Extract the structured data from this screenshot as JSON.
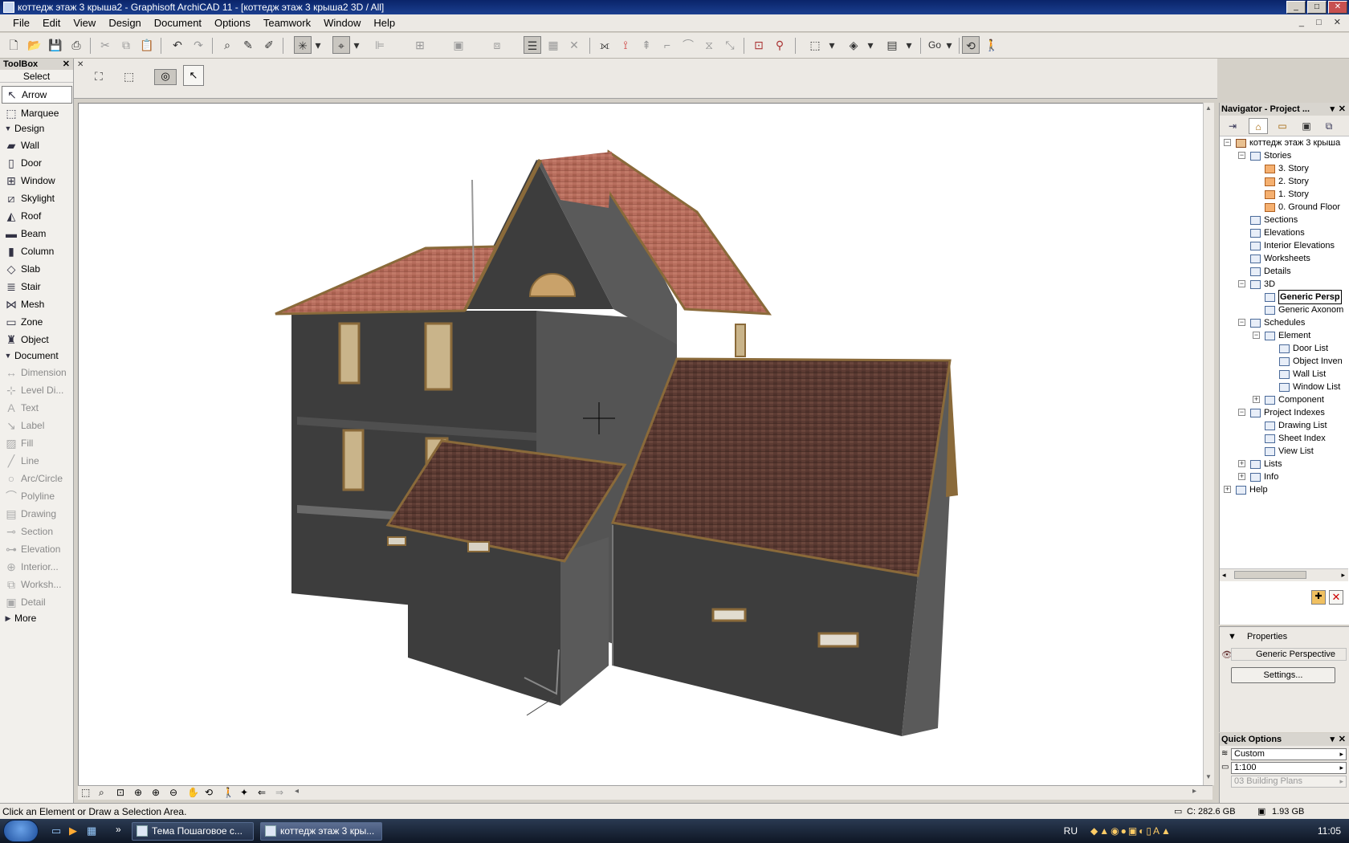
{
  "window": {
    "title": "коттедж этаж 3 крыша2 - Graphisoft ArchiCAD 11 - [коттедж этаж 3 крыша2 3D / All]",
    "minimize": "_",
    "maximize": "□",
    "close": "✕"
  },
  "menubar": {
    "items": [
      "File",
      "Edit",
      "View",
      "Design",
      "Document",
      "Options",
      "Teamwork",
      "Window",
      "Help"
    ],
    "mdi_controls": "_ □ ✕"
  },
  "toolbar": {
    "go_label": "Go"
  },
  "toolbox": {
    "title": "ToolBox",
    "close": "✕",
    "select_label": "Select",
    "select_tools": [
      {
        "label": "Arrow",
        "icon": "arrow-icon"
      },
      {
        "label": "Marquee",
        "icon": "marquee-icon"
      }
    ],
    "design_group": "Design",
    "design_tools": [
      {
        "label": "Wall",
        "icon": "wall-icon"
      },
      {
        "label": "Door",
        "icon": "door-icon"
      },
      {
        "label": "Window",
        "icon": "window-icon"
      },
      {
        "label": "Skylight",
        "icon": "skylight-icon"
      },
      {
        "label": "Roof",
        "icon": "roof-icon"
      },
      {
        "label": "Beam",
        "icon": "beam-icon"
      },
      {
        "label": "Column",
        "icon": "column-icon"
      },
      {
        "label": "Slab",
        "icon": "slab-icon"
      },
      {
        "label": "Stair",
        "icon": "stair-icon"
      },
      {
        "label": "Mesh",
        "icon": "mesh-icon"
      },
      {
        "label": "Zone",
        "icon": "zone-icon"
      },
      {
        "label": "Object",
        "icon": "object-icon"
      }
    ],
    "document_group": "Document",
    "document_tools": [
      {
        "label": "Dimension",
        "icon": "dimension-icon"
      },
      {
        "label": "Level Di...",
        "icon": "level-dimension-icon"
      },
      {
        "label": "Text",
        "icon": "text-icon"
      },
      {
        "label": "Label",
        "icon": "label-icon"
      },
      {
        "label": "Fill",
        "icon": "fill-icon"
      },
      {
        "label": "Line",
        "icon": "line-icon"
      },
      {
        "label": "Arc/Circle",
        "icon": "arc-circle-icon"
      },
      {
        "label": "Polyline",
        "icon": "polyline-icon"
      },
      {
        "label": "Drawing",
        "icon": "drawing-icon"
      },
      {
        "label": "Section",
        "icon": "section-icon"
      },
      {
        "label": "Elevation",
        "icon": "elevation-icon"
      },
      {
        "label": "Interior...",
        "icon": "interior-elevation-icon"
      },
      {
        "label": "Worksh...",
        "icon": "worksheet-icon"
      },
      {
        "label": "Detail",
        "icon": "detail-icon"
      }
    ],
    "more_label": "More"
  },
  "navigator": {
    "title": "Navigator - Project ...",
    "tree": [
      {
        "label": "коттедж этаж 3 крыша",
        "depth": 0,
        "icon": "house",
        "toggle": "−"
      },
      {
        "label": "Stories",
        "depth": 1,
        "icon": "folder",
        "toggle": "−"
      },
      {
        "label": "3. Story",
        "depth": 2,
        "icon": "story",
        "toggle": ""
      },
      {
        "label": "2. Story",
        "depth": 2,
        "icon": "story",
        "toggle": ""
      },
      {
        "label": "1. Story",
        "depth": 2,
        "icon": "story",
        "toggle": ""
      },
      {
        "label": "0. Ground Floor",
        "depth": 2,
        "icon": "story",
        "toggle": ""
      },
      {
        "label": "Sections",
        "depth": 1,
        "icon": "folder",
        "toggle": ""
      },
      {
        "label": "Elevations",
        "depth": 1,
        "icon": "folder",
        "toggle": ""
      },
      {
        "label": "Interior Elevations",
        "depth": 1,
        "icon": "folder",
        "toggle": ""
      },
      {
        "label": "Worksheets",
        "depth": 1,
        "icon": "folder",
        "toggle": ""
      },
      {
        "label": "Details",
        "depth": 1,
        "icon": "folder",
        "toggle": ""
      },
      {
        "label": "3D",
        "depth": 1,
        "icon": "folder",
        "toggle": "−"
      },
      {
        "label": "Generic Persp",
        "depth": 2,
        "icon": "camera",
        "toggle": "",
        "selected": true
      },
      {
        "label": "Generic Axonom",
        "depth": 2,
        "icon": "cube",
        "toggle": ""
      },
      {
        "label": "Schedules",
        "depth": 1,
        "icon": "folder",
        "toggle": "−"
      },
      {
        "label": "Element",
        "depth": 2,
        "icon": "folder",
        "toggle": "−"
      },
      {
        "label": "Door List",
        "depth": 3,
        "icon": "list",
        "toggle": ""
      },
      {
        "label": "Object Inven",
        "depth": 3,
        "icon": "list",
        "toggle": ""
      },
      {
        "label": "Wall List",
        "depth": 3,
        "icon": "list",
        "toggle": ""
      },
      {
        "label": "Window List",
        "depth": 3,
        "icon": "list",
        "toggle": ""
      },
      {
        "label": "Component",
        "depth": 2,
        "icon": "folder",
        "toggle": "+"
      },
      {
        "label": "Project Indexes",
        "depth": 1,
        "icon": "folder",
        "toggle": "−"
      },
      {
        "label": "Drawing List",
        "depth": 2,
        "icon": "list",
        "toggle": ""
      },
      {
        "label": "Sheet Index",
        "depth": 2,
        "icon": "list",
        "toggle": ""
      },
      {
        "label": "View List",
        "depth": 2,
        "icon": "list",
        "toggle": ""
      },
      {
        "label": "Lists",
        "depth": 1,
        "icon": "folder",
        "toggle": "+"
      },
      {
        "label": "Info",
        "depth": 1,
        "icon": "folder",
        "toggle": "+"
      },
      {
        "label": "Help",
        "depth": 0,
        "icon": "folder",
        "toggle": "+"
      }
    ]
  },
  "properties": {
    "header": "Properties",
    "view_name": "Generic Perspective",
    "settings_button": "Settings..."
  },
  "quick_options": {
    "title": "Quick Options",
    "rows": [
      {
        "value": "Custom",
        "disabled": false
      },
      {
        "value": "1:100",
        "disabled": false
      },
      {
        "value": "03 Building Plans",
        "disabled": true
      }
    ]
  },
  "statusbar": {
    "hint": "Click an Element or Draw a Selection Area.",
    "disk": "C: 282.6 GB",
    "memory": "1.93 GB"
  },
  "taskbar": {
    "tasks": [
      {
        "label": "Тема Пошаговое с...",
        "active": false
      },
      {
        "label": "коттедж этаж 3 кры...",
        "active": true
      }
    ],
    "lang": "RU",
    "clock": "11:05"
  },
  "colors": {
    "wall_front": "#3d3d3d",
    "wall_side": "#5a5a5a",
    "roof_red": "#b06a5a",
    "roof_brown": "#5a3a32",
    "trim": "#8a6a3a"
  }
}
